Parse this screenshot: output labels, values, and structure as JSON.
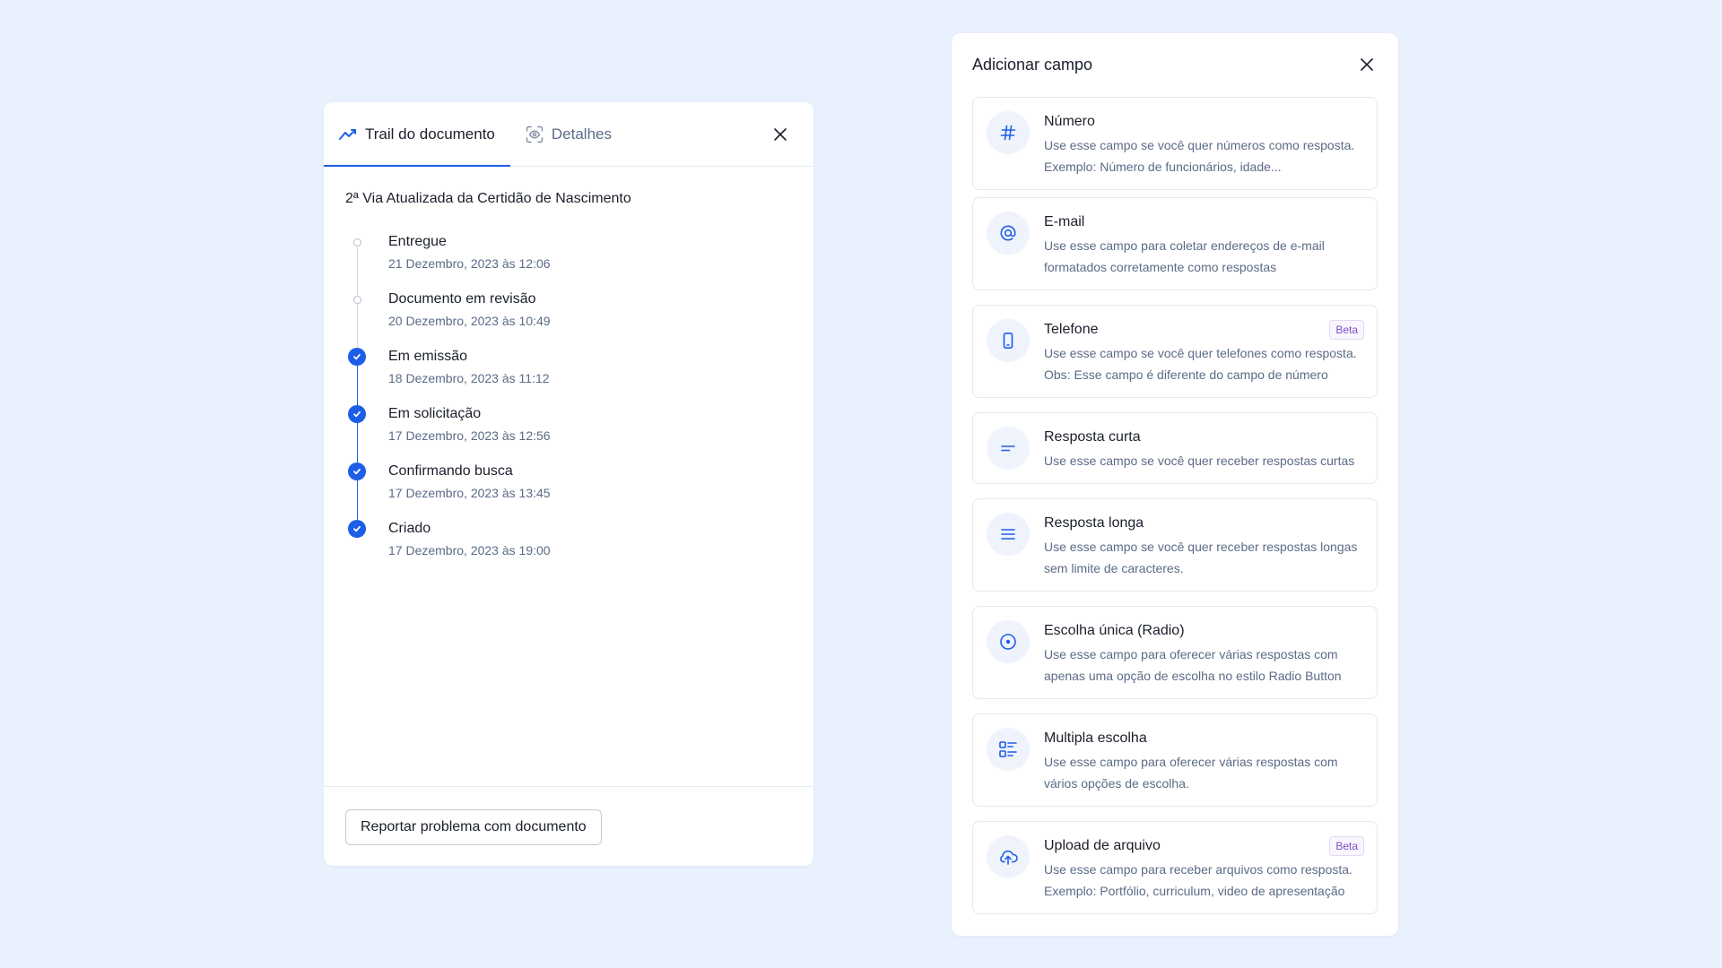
{
  "trail": {
    "tabs": [
      {
        "label": "Trail do documento",
        "icon": "trend-line-icon",
        "active": true
      },
      {
        "label": "Detalhes",
        "icon": "scan-eye-icon",
        "active": false
      }
    ],
    "document_title": "2ª Via Atualizada da Certidão de Nascimento",
    "events": [
      {
        "title": "Entregue",
        "date": "21 Dezembro, 2023 às 12:06",
        "status": "pending"
      },
      {
        "title": "Documento em revisão",
        "date": "20 Dezembro, 2023 às 10:49",
        "status": "pending"
      },
      {
        "title": "Em emissão",
        "date": "18 Dezembro, 2023 às 11:12",
        "status": "done"
      },
      {
        "title": "Em solicitação",
        "date": "17 Dezembro, 2023 às 12:56",
        "status": "done"
      },
      {
        "title": "Confirmando busca",
        "date": "17 Dezembro, 2023 às 13:45",
        "status": "done"
      },
      {
        "title": "Criado",
        "date": "17 Dezembro, 2023 às 19:00",
        "status": "done"
      }
    ],
    "report_button": "Reportar problema com documento"
  },
  "add_field": {
    "title": "Adicionar campo",
    "fields": [
      {
        "name": "Número",
        "icon": "hash-icon",
        "desc": "Use esse campo se você quer números como resposta. Exemplo: Número de funcionários, idade...",
        "badge": ""
      },
      {
        "name": "E-mail",
        "icon": "at-sign-icon",
        "desc": "Use esse campo para coletar endereços de e-mail formatados corretamente como respostas",
        "badge": ""
      },
      {
        "name": "Telefone",
        "icon": "phone-device-icon",
        "desc": "Use esse campo se você quer telefones como resposta. Obs: Esse campo é diferente do campo de número",
        "badge": "Beta"
      },
      {
        "name": "Resposta curta",
        "icon": "short-text-icon",
        "desc": "Use esse campo se você quer receber respostas curtas",
        "badge": ""
      },
      {
        "name": "Resposta longa",
        "icon": "long-text-icon",
        "desc": "Use esse campo se você quer receber respostas longas sem limite de caracteres.",
        "badge": ""
      },
      {
        "name": "Escolha única (Radio)",
        "icon": "radio-icon",
        "desc": "Use esse campo para oferecer várias respostas com apenas uma opção de escolha no estilo Radio Button",
        "badge": ""
      },
      {
        "name": "Multipla escolha",
        "icon": "checklist-icon",
        "desc": "Use esse campo para oferecer várias respostas com vários opções de escolha.",
        "badge": ""
      },
      {
        "name": "Upload de arquivo",
        "icon": "cloud-upload-icon",
        "desc": "Use esse campo para receber arquivos como resposta. Exemplo: Portfólio, curriculum, video de apresentação",
        "badge": "Beta"
      }
    ]
  },
  "colors": {
    "accent": "#1d5ee8",
    "background": "#e8f1fd",
    "muted_text": "#5b6b87",
    "beta_text": "#7b4fc4"
  }
}
